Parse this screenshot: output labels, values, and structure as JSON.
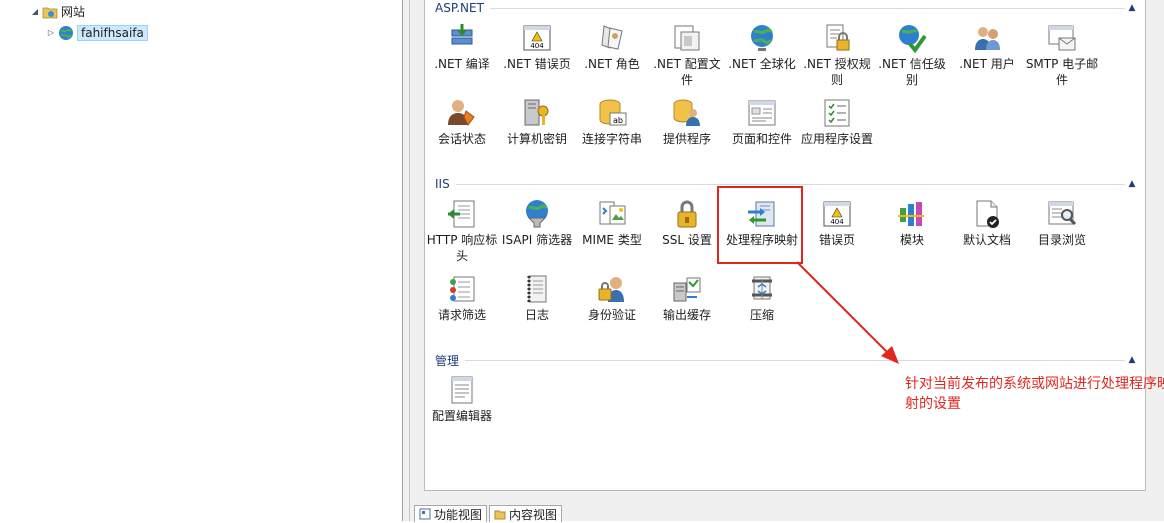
{
  "tree": {
    "sites_label": "网站",
    "site_item": "fahifhsaifa"
  },
  "groups": [
    {
      "title": "ASP.NET",
      "features": [
        {
          "label": ".NET 编译",
          "icon": "compile-icon"
        },
        {
          "label": ".NET 错误页",
          "icon": "error-page-404-icon"
        },
        {
          "label": ".NET 角色",
          "icon": "roles-icon"
        },
        {
          "label": ".NET 配置文件",
          "icon": "profile-icon"
        },
        {
          "label": ".NET 全球化",
          "icon": "globe-icon"
        },
        {
          "label": ".NET 授权规则",
          "icon": "authorization-lock-icon"
        },
        {
          "label": ".NET 信任级别",
          "icon": "trust-level-icon"
        },
        {
          "label": ".NET 用户",
          "icon": "users-icon"
        },
        {
          "label": "SMTP 电子邮件",
          "icon": "smtp-mail-icon"
        },
        {
          "label": "会话状态",
          "icon": "session-state-icon"
        },
        {
          "label": "计算机密钥",
          "icon": "machine-key-icon"
        },
        {
          "label": "连接字符串",
          "icon": "connection-string-icon"
        },
        {
          "label": "提供程序",
          "icon": "providers-icon"
        },
        {
          "label": "页面和控件",
          "icon": "pages-controls-icon"
        },
        {
          "label": "应用程序设置",
          "icon": "app-settings-icon"
        }
      ]
    },
    {
      "title": "IIS",
      "features": [
        {
          "label": "HTTP 响应标头",
          "icon": "http-headers-icon"
        },
        {
          "label": "ISAPI 筛选器",
          "icon": "isapi-filter-icon"
        },
        {
          "label": "MIME 类型",
          "icon": "mime-types-icon"
        },
        {
          "label": "SSL 设置",
          "icon": "ssl-lock-icon"
        },
        {
          "label": "处理程序映射",
          "icon": "handler-mappings-icon"
        },
        {
          "label": "错误页",
          "icon": "error-pages-icon"
        },
        {
          "label": "模块",
          "icon": "modules-icon"
        },
        {
          "label": "默认文档",
          "icon": "default-document-icon"
        },
        {
          "label": "目录浏览",
          "icon": "directory-browsing-icon"
        },
        {
          "label": "请求筛选",
          "icon": "request-filtering-icon"
        },
        {
          "label": "日志",
          "icon": "logging-icon"
        },
        {
          "label": "身份验证",
          "icon": "authentication-icon"
        },
        {
          "label": "输出缓存",
          "icon": "output-caching-icon"
        },
        {
          "label": "压缩",
          "icon": "compression-icon"
        }
      ]
    },
    {
      "title": "管理",
      "features": [
        {
          "label": "配置编辑器",
          "icon": "configuration-editor-icon"
        }
      ]
    }
  ],
  "annotation": {
    "text": "针对当前发布的系统或网站进行处理程序映射的设置",
    "color": "#e0271f"
  },
  "bottom_tabs": [
    {
      "label": "功能视图"
    },
    {
      "label": "内容视图"
    }
  ],
  "colors": {
    "group_title": "#1e3c7b",
    "selection": "#cde8ff"
  }
}
